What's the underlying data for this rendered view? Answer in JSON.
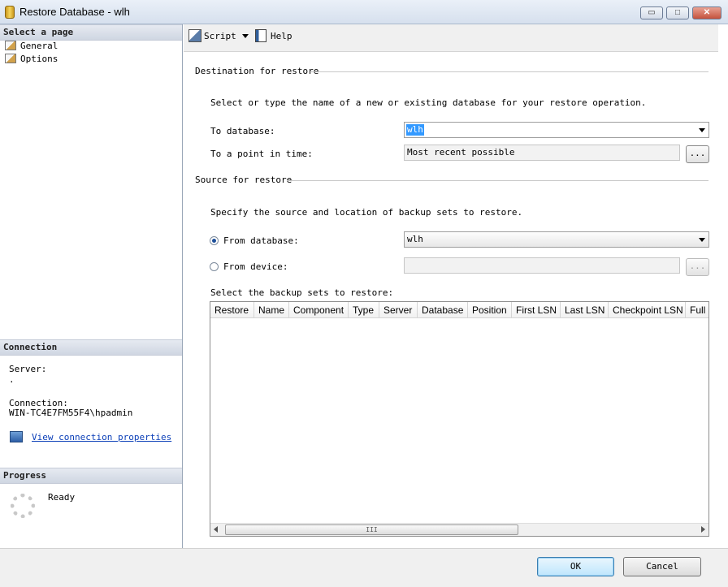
{
  "window": {
    "title": "Restore Database - wlh",
    "minimize_label": "▭",
    "maximize_label": "□",
    "close_label": "✕"
  },
  "left": {
    "select_page_header": "Select a page",
    "pages": [
      {
        "label": "General"
      },
      {
        "label": "Options"
      }
    ],
    "connection_header": "Connection",
    "server_label": "Server:",
    "server_value": ".",
    "connection_label": "Connection:",
    "connection_value": "WIN-TC4E7FM55F4\\hpadmin",
    "view_props_link": "View connection properties",
    "progress_header": "Progress",
    "progress_status": "Ready"
  },
  "toolbar": {
    "script_label": "Script",
    "help_label": "Help"
  },
  "destination": {
    "group_title": "Destination for restore",
    "instructions": "Select or type the name of a new or existing database for your restore operation.",
    "to_database_label": "To database:",
    "to_database_value": "wlh",
    "point_in_time_label": "To a point in time:",
    "point_in_time_value": "Most recent possible",
    "browse_label": "..."
  },
  "source": {
    "group_title": "Source for restore",
    "instructions": "Specify the source and location of backup sets to restore.",
    "from_database_label": "From database:",
    "from_database_value": "wlh",
    "from_device_label": "From device:",
    "device_browse_label": "...",
    "backup_sets_label": "Select the backup sets to restore:",
    "columns": [
      "Restore",
      "Name",
      "Component",
      "Type",
      "Server",
      "Database",
      "Position",
      "First LSN",
      "Last LSN",
      "Checkpoint LSN",
      "Full L"
    ],
    "scroll_grip": "III"
  },
  "footer": {
    "ok_label": "OK",
    "cancel_label": "Cancel"
  }
}
